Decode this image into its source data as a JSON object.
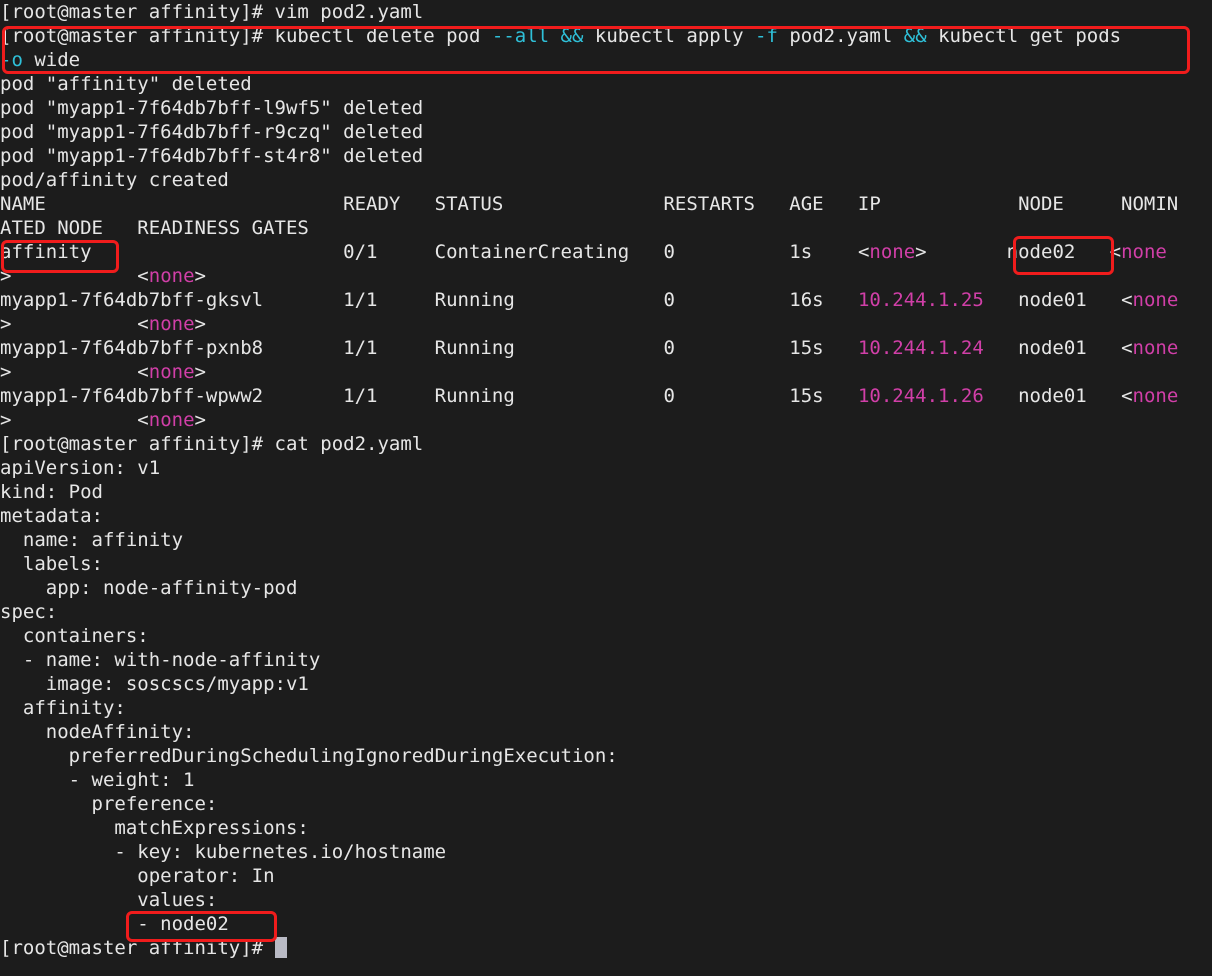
{
  "terminal": {
    "background": "#1c1c1c",
    "foreground": "#e6e6e6",
    "accent_cyan": "#2fc0d8",
    "accent_magenta": "#d13fa8",
    "highlight_box_color": "#f01c1c",
    "prompt": "[root@master affinity]#",
    "columns": 100,
    "rows": 41
  },
  "lines": [
    {
      "id": "l01",
      "segments": [
        {
          "t": "[root@master affinity]# vim pod2.yaml",
          "c": "w"
        }
      ]
    },
    {
      "id": "l02",
      "segments": [
        {
          "t": "[root@master affinity]# kubectl delete pod ",
          "c": "w"
        },
        {
          "t": "--all",
          "c": "cy"
        },
        {
          "t": " ",
          "c": "w"
        },
        {
          "t": "&&",
          "c": "cy"
        },
        {
          "t": " kubectl apply ",
          "c": "w"
        },
        {
          "t": "-f",
          "c": "cy"
        },
        {
          "t": " pod2.yaml ",
          "c": "w"
        },
        {
          "t": "&&",
          "c": "cy"
        },
        {
          "t": " kubectl get pods",
          "c": "w"
        }
      ]
    },
    {
      "id": "l03",
      "segments": [
        {
          "t": "-o",
          "c": "cy"
        },
        {
          "t": " wide",
          "c": "w"
        }
      ]
    },
    {
      "id": "l04",
      "segments": [
        {
          "t": "pod \"affinity\" deleted",
          "c": "w"
        }
      ]
    },
    {
      "id": "l05",
      "segments": [
        {
          "t": "pod \"myapp1-7f64db7bff-l9wf5\" deleted",
          "c": "w"
        }
      ]
    },
    {
      "id": "l06",
      "segments": [
        {
          "t": "pod \"myapp1-7f64db7bff-r9czq\" deleted",
          "c": "w"
        }
      ]
    },
    {
      "id": "l07",
      "segments": [
        {
          "t": "pod \"myapp1-7f64db7bff-st4r8\" deleted",
          "c": "w"
        }
      ]
    },
    {
      "id": "l08",
      "segments": [
        {
          "t": "pod/affinity created",
          "c": "w"
        }
      ]
    },
    {
      "id": "l09",
      "segments": [
        {
          "t": "NAME                          READY   STATUS              RESTARTS   AGE   IP            NODE     NOMIN",
          "c": "w"
        }
      ]
    },
    {
      "id": "l10",
      "segments": [
        {
          "t": "ATED NODE   READINESS GATES",
          "c": "w"
        }
      ]
    },
    {
      "id": "l11",
      "segments": [
        {
          "t": "affinity                      0/1     ContainerCreating   0          1s    ",
          "c": "w"
        },
        {
          "t": "<",
          "c": "w"
        },
        {
          "t": "none",
          "c": "mg"
        },
        {
          "t": ">",
          "c": "w"
        },
        {
          "t": "       node02   ",
          "c": "w"
        },
        {
          "t": "<",
          "c": "w"
        },
        {
          "t": "none",
          "c": "mg"
        }
      ]
    },
    {
      "id": "l12",
      "segments": [
        {
          "t": ">",
          "c": "w"
        },
        {
          "t": "           ",
          "c": "w"
        },
        {
          "t": "<",
          "c": "w"
        },
        {
          "t": "none",
          "c": "mg"
        },
        {
          "t": ">",
          "c": "w"
        }
      ]
    },
    {
      "id": "l13",
      "segments": [
        {
          "t": "myapp1-7f64db7bff-gksvl       1/1     Running             0          16s   ",
          "c": "w"
        },
        {
          "t": "10.244.1.25",
          "c": "mg"
        },
        {
          "t": "   node01   ",
          "c": "w"
        },
        {
          "t": "<",
          "c": "w"
        },
        {
          "t": "none",
          "c": "mg"
        }
      ]
    },
    {
      "id": "l14",
      "segments": [
        {
          "t": ">",
          "c": "w"
        },
        {
          "t": "           ",
          "c": "w"
        },
        {
          "t": "<",
          "c": "w"
        },
        {
          "t": "none",
          "c": "mg"
        },
        {
          "t": ">",
          "c": "w"
        }
      ]
    },
    {
      "id": "l15",
      "segments": [
        {
          "t": "myapp1-7f64db7bff-pxnb8       1/1     Running             0          15s   ",
          "c": "w"
        },
        {
          "t": "10.244.1.24",
          "c": "mg"
        },
        {
          "t": "   node01   ",
          "c": "w"
        },
        {
          "t": "<",
          "c": "w"
        },
        {
          "t": "none",
          "c": "mg"
        }
      ]
    },
    {
      "id": "l16",
      "segments": [
        {
          "t": ">",
          "c": "w"
        },
        {
          "t": "           ",
          "c": "w"
        },
        {
          "t": "<",
          "c": "w"
        },
        {
          "t": "none",
          "c": "mg"
        },
        {
          "t": ">",
          "c": "w"
        }
      ]
    },
    {
      "id": "l17",
      "segments": [
        {
          "t": "myapp1-7f64db7bff-wpww2       1/1     Running             0          15s   ",
          "c": "w"
        },
        {
          "t": "10.244.1.26",
          "c": "mg"
        },
        {
          "t": "   node01   ",
          "c": "w"
        },
        {
          "t": "<",
          "c": "w"
        },
        {
          "t": "none",
          "c": "mg"
        }
      ]
    },
    {
      "id": "l18",
      "segments": [
        {
          "t": ">",
          "c": "w"
        },
        {
          "t": "           ",
          "c": "w"
        },
        {
          "t": "<",
          "c": "w"
        },
        {
          "t": "none",
          "c": "mg"
        },
        {
          "t": ">",
          "c": "w"
        }
      ]
    },
    {
      "id": "l19",
      "segments": [
        {
          "t": "[root@master affinity]# cat pod2.yaml",
          "c": "w"
        }
      ]
    },
    {
      "id": "l20",
      "segments": [
        {
          "t": "apiVersion: v1",
          "c": "w"
        }
      ]
    },
    {
      "id": "l21",
      "segments": [
        {
          "t": "kind: Pod",
          "c": "w"
        }
      ]
    },
    {
      "id": "l22",
      "segments": [
        {
          "t": "metadata:",
          "c": "w"
        }
      ]
    },
    {
      "id": "l23",
      "segments": [
        {
          "t": "  name: affinity",
          "c": "w"
        }
      ]
    },
    {
      "id": "l24",
      "segments": [
        {
          "t": "  labels:",
          "c": "w"
        }
      ]
    },
    {
      "id": "l25",
      "segments": [
        {
          "t": "    app: node-affinity-pod",
          "c": "w"
        }
      ]
    },
    {
      "id": "l26",
      "segments": [
        {
          "t": "spec:",
          "c": "w"
        }
      ]
    },
    {
      "id": "l27",
      "segments": [
        {
          "t": "  containers:",
          "c": "w"
        }
      ]
    },
    {
      "id": "l28",
      "segments": [
        {
          "t": "  - name: with-node-affinity",
          "c": "w"
        }
      ]
    },
    {
      "id": "l29",
      "segments": [
        {
          "t": "    image: soscscs/myapp:v1",
          "c": "w"
        }
      ]
    },
    {
      "id": "l30",
      "segments": [
        {
          "t": "  affinity:",
          "c": "w"
        }
      ]
    },
    {
      "id": "l31",
      "segments": [
        {
          "t": "    nodeAffinity:",
          "c": "w"
        }
      ]
    },
    {
      "id": "l32",
      "segments": [
        {
          "t": "      preferredDuringSchedulingIgnoredDuringExecution:",
          "c": "w"
        }
      ]
    },
    {
      "id": "l33",
      "segments": [
        {
          "t": "      - weight: 1",
          "c": "w"
        }
      ]
    },
    {
      "id": "l34",
      "segments": [
        {
          "t": "        preference:",
          "c": "w"
        }
      ]
    },
    {
      "id": "l35",
      "segments": [
        {
          "t": "          matchExpressions:",
          "c": "w"
        }
      ]
    },
    {
      "id": "l36",
      "segments": [
        {
          "t": "          - key: kubernetes.io/hostname",
          "c": "w"
        }
      ]
    },
    {
      "id": "l37",
      "segments": [
        {
          "t": "            operator: In",
          "c": "w"
        }
      ]
    },
    {
      "id": "l38",
      "segments": [
        {
          "t": "            values:",
          "c": "w"
        }
      ]
    },
    {
      "id": "l39",
      "segments": [
        {
          "t": "            - node02",
          "c": "w"
        }
      ]
    },
    {
      "id": "l40",
      "segments": [
        {
          "t": "[root@master affinity]# ",
          "c": "w"
        },
        {
          "t": "",
          "c": "cursor"
        }
      ]
    }
  ],
  "pods_table": {
    "headers": [
      "NAME",
      "READY",
      "STATUS",
      "RESTARTS",
      "AGE",
      "IP",
      "NODE",
      "NOMINATED NODE",
      "READINESS GATES"
    ],
    "rows": [
      {
        "name": "affinity",
        "ready": "0/1",
        "status": "ContainerCreating",
        "restarts": "0",
        "age": "1s",
        "ip": "<none>",
        "node": "node02",
        "nominated_node": "<none>",
        "readiness_gates": "<none>"
      },
      {
        "name": "myapp1-7f64db7bff-gksvl",
        "ready": "1/1",
        "status": "Running",
        "restarts": "0",
        "age": "16s",
        "ip": "10.244.1.25",
        "node": "node01",
        "nominated_node": "<none>",
        "readiness_gates": "<none>"
      },
      {
        "name": "myapp1-7f64db7bff-pxnb8",
        "ready": "1/1",
        "status": "Running",
        "restarts": "0",
        "age": "15s",
        "ip": "10.244.1.24",
        "node": "node01",
        "nominated_node": "<none>",
        "readiness_gates": "<none>"
      },
      {
        "name": "myapp1-7f64db7bff-wpww2",
        "ready": "1/1",
        "status": "Running",
        "restarts": "0",
        "age": "15s",
        "ip": "10.244.1.26",
        "node": "node01",
        "nominated_node": "<none>",
        "readiness_gates": "<none>"
      }
    ]
  },
  "highlights": [
    {
      "id": "box-cmd",
      "label": "kubectl delete pod --all && kubectl apply -f pod2.yaml && kubectl get pods -o wide"
    },
    {
      "id": "box-affinity",
      "label": "affinity"
    },
    {
      "id": "box-node02-a",
      "label": "node02"
    },
    {
      "id": "box-node02-b",
      "label": "- node02"
    }
  ]
}
